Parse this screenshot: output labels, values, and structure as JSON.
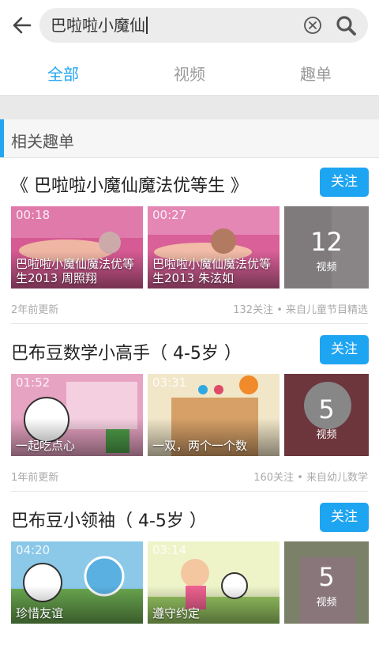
{
  "search": {
    "query": "巴啦啦小魔仙"
  },
  "tabs": [
    {
      "label": "全部",
      "active": true
    },
    {
      "label": "视频",
      "active": false
    },
    {
      "label": "趣单",
      "active": false
    }
  ],
  "section": {
    "title": "相关趣单"
  },
  "follow_label": "关注",
  "count_unit": "视频",
  "cards": [
    {
      "title": "《 巴啦啦小魔仙魔法优等生 》",
      "videos": [
        {
          "duration": "00:18",
          "caption": "巴啦啦小魔仙魔法优等生2013 周照翔"
        },
        {
          "duration": "00:27",
          "caption": "巴啦啦小魔仙魔法优等生2013 朱泫如"
        }
      ],
      "count": "12",
      "updated": "2年前更新",
      "stats": "132关注 • 来自儿童节目精选"
    },
    {
      "title": "巴布豆数学小高手（ 4-5岁 ）",
      "videos": [
        {
          "duration": "01:52",
          "caption": "一起吃点心"
        },
        {
          "duration": "03:31",
          "caption": "一双，两个一个数"
        }
      ],
      "count": "5",
      "updated": "1年前更新",
      "stats": "160关注 • 来自幼儿数学"
    },
    {
      "title": "巴布豆小领袖（ 4-5岁 ）",
      "videos": [
        {
          "duration": "04:20",
          "caption": "珍惜友谊"
        },
        {
          "duration": "03:14",
          "caption": "遵守约定"
        }
      ],
      "count": "5",
      "updated": "",
      "stats": ""
    }
  ],
  "colors": {
    "accent": "#1ea5f2",
    "tab_inactive": "#9a9a9a"
  }
}
